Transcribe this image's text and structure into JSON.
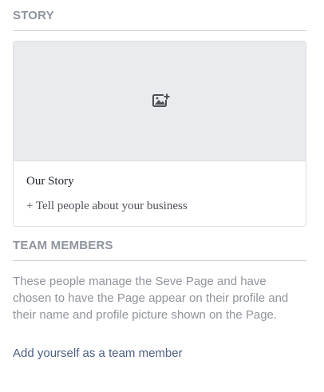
{
  "story": {
    "header": "STORY",
    "cover_icon": "add-photo-icon",
    "title": "Our Story",
    "link": "+ Tell people about your business"
  },
  "team": {
    "header": "TEAM MEMBERS",
    "description": "These people manage the Seve Page and have chosen to have the Page appear on their profile and their name and profile picture shown on the Page.",
    "link": "Add yourself as a team member"
  },
  "colors": {
    "header_text": "#8d949e",
    "divider": "#ccd0d5",
    "placeholder_bg": "#e9ebee",
    "link_blue": "#4b5f83",
    "muted_text": "#90949c"
  }
}
